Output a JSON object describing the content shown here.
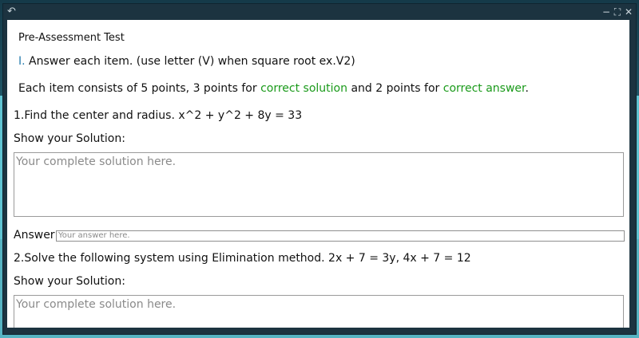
{
  "window": {
    "back_icon": "↶",
    "minimize_icon": "−",
    "maximize_icon": "⛶",
    "close_icon": "✕"
  },
  "test": {
    "title": "Pre-Assessment Test",
    "instruction_prefix": "I.",
    "instruction_text": " Answer each item. (use letter (V) when square root ex.V2)",
    "scoring": {
      "part1": "Each item consists of 5 points, 3 points for ",
      "highlight1": "correct solution",
      "part2": " and 2 points for ",
      "highlight2": "correct answer",
      "part3": "."
    }
  },
  "items": [
    {
      "question": "1.Find the center and radius. x^2 + y^2 + 8y = 33",
      "solution_label": "Show your Solution:",
      "solution_placeholder": "Your complete solution here.",
      "answer_label": "Answer:",
      "answer_placeholder": "Your answer here."
    },
    {
      "question": "2.Solve the following system using Elimination method. 2x + 7 = 3y, 4x + 7 = 12",
      "solution_label": "Show your Solution:",
      "solution_placeholder": "Your complete solution here."
    }
  ],
  "colors": {
    "highlight_green": "#1a9a1a",
    "window_chrome": "#1c3340",
    "desktop_teal": "#5fc3d2"
  }
}
